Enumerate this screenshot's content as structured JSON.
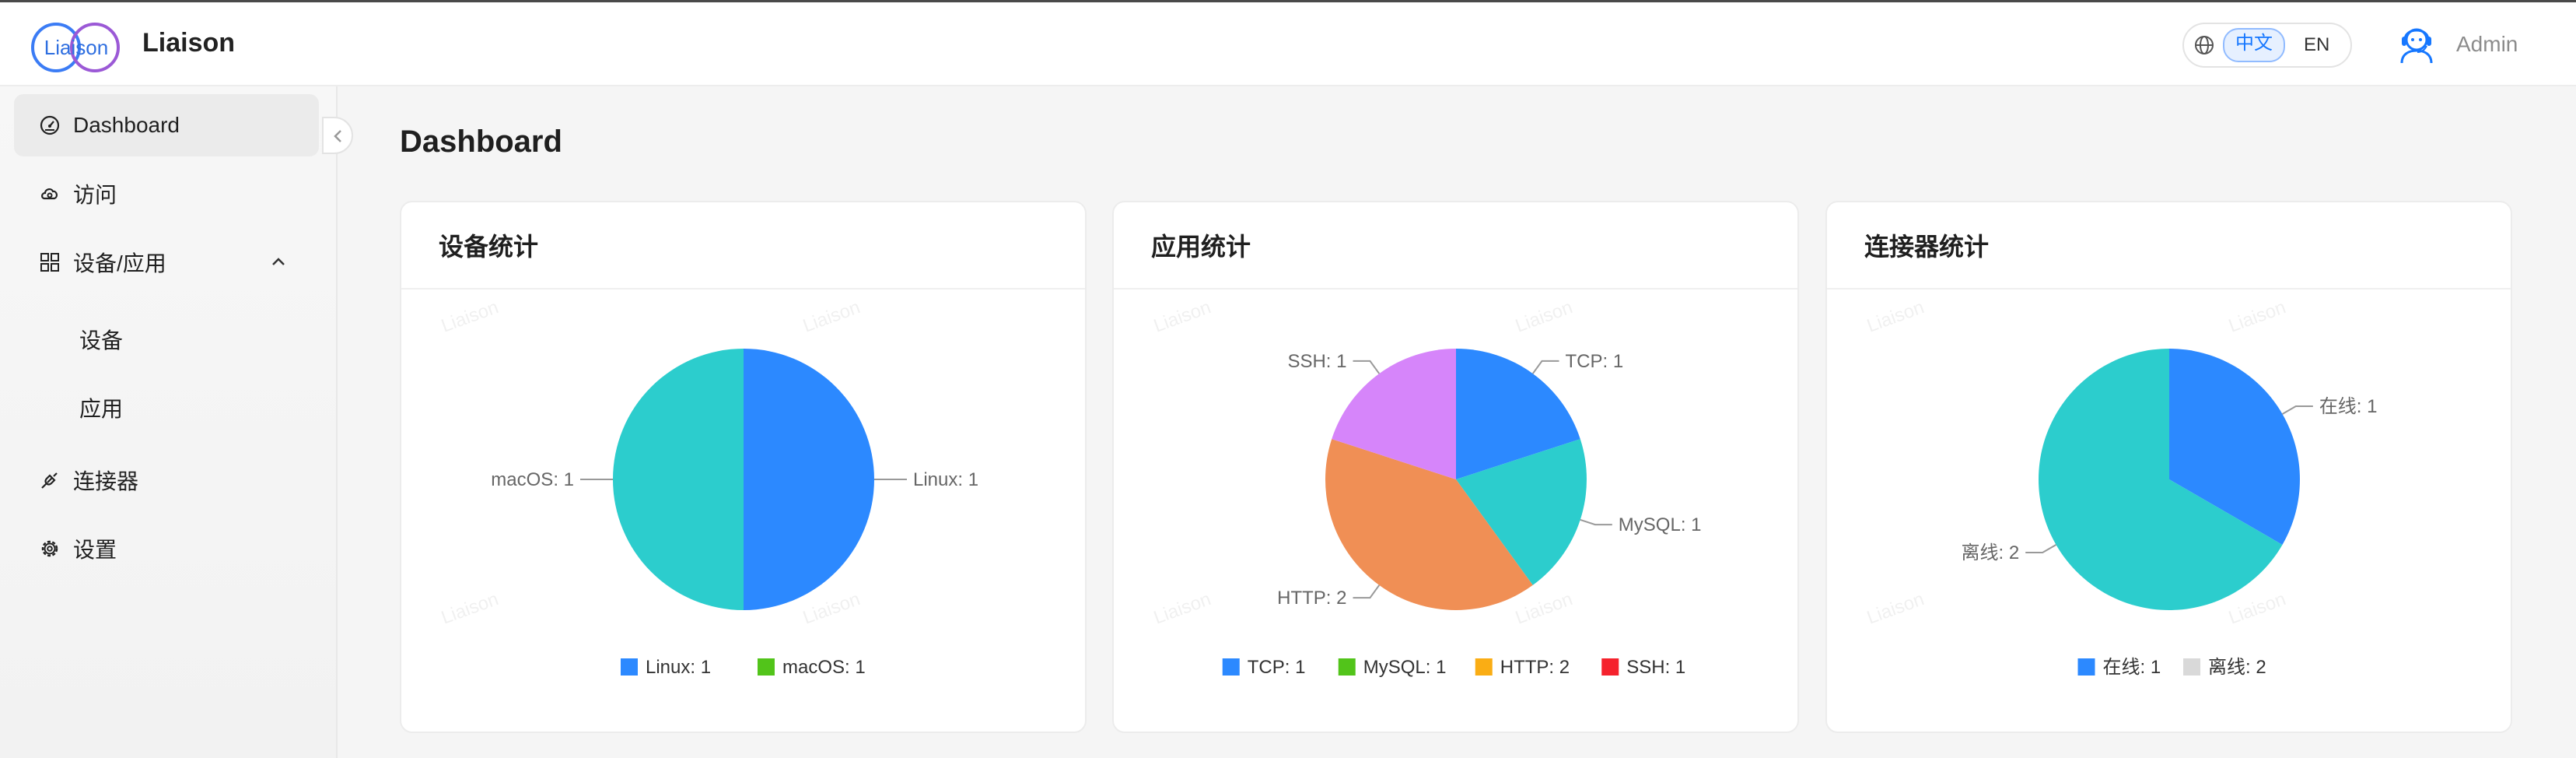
{
  "app": {
    "title": "Liaison",
    "logo_text": "Liaison"
  },
  "header": {
    "languages": [
      {
        "label": "中文",
        "active": true
      },
      {
        "label": "EN",
        "active": false
      }
    ],
    "user_name": "Admin"
  },
  "sidebar": {
    "items": [
      {
        "label": "Dashboard",
        "icon": "dashboard-icon",
        "active": true
      },
      {
        "label": "访问",
        "icon": "cloud-access-icon"
      },
      {
        "label": "设备/应用",
        "icon": "grid-icon",
        "expanded": true,
        "children": [
          {
            "label": "设备"
          },
          {
            "label": "应用"
          }
        ]
      },
      {
        "label": "连接器",
        "icon": "plug-icon"
      },
      {
        "label": "设置",
        "icon": "gear-icon"
      }
    ]
  },
  "main": {
    "title": "Dashboard"
  },
  "watermark": "Liaison",
  "colors": {
    "blue": "#2c89ff",
    "teal": "#2ccdcd",
    "orange": "#f08f55",
    "violet": "#d685fa",
    "legend_green": "#52c41a",
    "legend_orange": "#faad14",
    "legend_red": "#f5222d",
    "legend_gray": "#d9d9d9"
  },
  "chart_data": [
    {
      "type": "pie",
      "title": "设备统计",
      "slices": [
        {
          "name": "Linux",
          "value": 1,
          "label": "Linux: 1",
          "color": "#2c89ff"
        },
        {
          "name": "macOS",
          "value": 1,
          "label": "macOS: 1",
          "color": "#2ccdcd"
        }
      ],
      "legend": [
        {
          "label": "Linux: 1",
          "color": "#2c89ff"
        },
        {
          "label": "macOS: 1",
          "color": "#52c41a"
        }
      ],
      "legend_position": "bottom"
    },
    {
      "type": "pie",
      "title": "应用统计",
      "slices": [
        {
          "name": "TCP",
          "value": 1,
          "label": "TCP: 1",
          "color": "#2c89ff"
        },
        {
          "name": "MySQL",
          "value": 1,
          "label": "MySQL: 1",
          "color": "#2ccdcd"
        },
        {
          "name": "HTTP",
          "value": 2,
          "label": "HTTP: 2",
          "color": "#f08f55"
        },
        {
          "name": "SSH",
          "value": 1,
          "label": "SSH: 1",
          "color": "#d685fa"
        }
      ],
      "legend": [
        {
          "label": "TCP: 1",
          "color": "#2c89ff"
        },
        {
          "label": "MySQL: 1",
          "color": "#52c41a"
        },
        {
          "label": "HTTP: 2",
          "color": "#faad14"
        },
        {
          "label": "SSH: 1",
          "color": "#f5222d"
        }
      ],
      "legend_position": "bottom"
    },
    {
      "type": "pie",
      "title": "连接器统计",
      "slices": [
        {
          "name": "在线",
          "value": 1,
          "label": "在线: 1",
          "color": "#2c89ff"
        },
        {
          "name": "离线",
          "value": 2,
          "label": "离线: 2",
          "color": "#2ccdcd"
        }
      ],
      "legend": [
        {
          "label": "在线: 1",
          "color": "#2c89ff"
        },
        {
          "label": "离线: 2",
          "color": "#d9d9d9"
        }
      ],
      "legend_position": "bottom"
    }
  ]
}
